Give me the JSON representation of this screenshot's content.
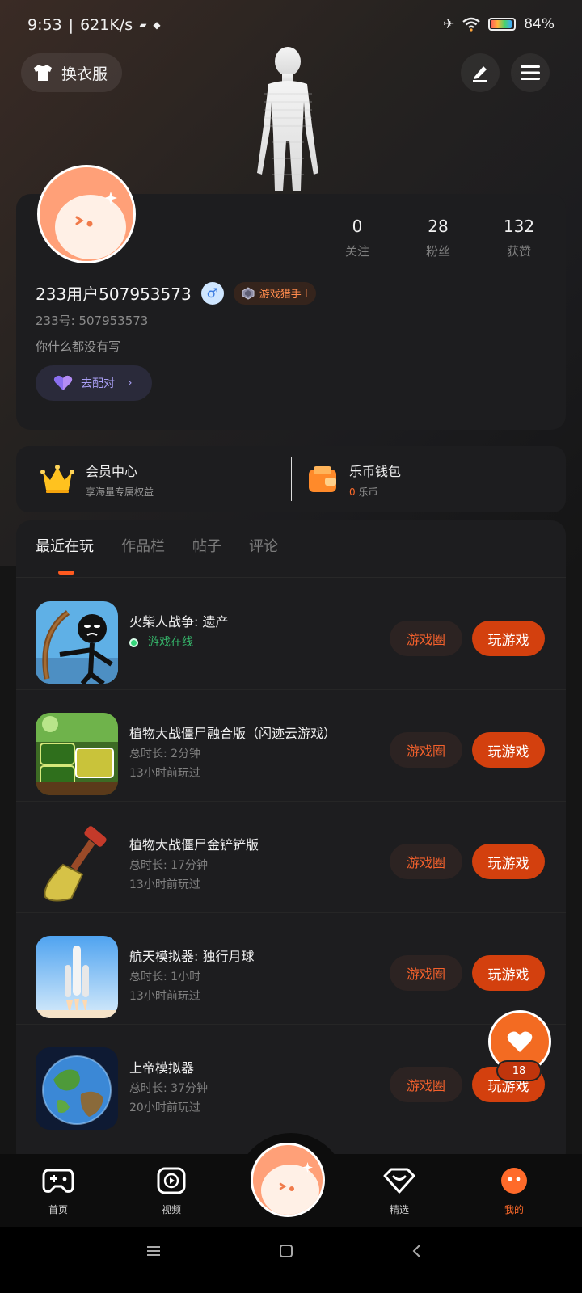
{
  "status_bar": {
    "time": "9:53",
    "speed": "621K/s",
    "battery": "84%"
  },
  "header": {
    "outfit_label": "换衣服",
    "edit_icon": "pencil-icon",
    "menu_icon": "hamburger-icon"
  },
  "profile": {
    "stats": [
      {
        "value": "0",
        "label": "关注"
      },
      {
        "value": "28",
        "label": "粉丝"
      },
      {
        "value": "132",
        "label": "获赞"
      }
    ],
    "username": "233用户507953573",
    "gender_symbol": "♂",
    "badge": "游戏猎手 I",
    "uid": "233号: 507953573",
    "bio": "你什么都没有写",
    "match_label": "去配对"
  },
  "membership": {
    "vip_title": "会员中心",
    "vip_sub": "享海量专属权益",
    "wallet_title": "乐币钱包",
    "wallet_amount": "0",
    "wallet_unit": "乐币"
  },
  "tabs": [
    "最近在玩",
    "作品栏",
    "帖子",
    "评论"
  ],
  "games": [
    {
      "name": "火柴人战争: 遗产",
      "online": "游戏在线",
      "meta1": "",
      "meta2": "",
      "circle": "游戏圈",
      "play": "玩游戏"
    },
    {
      "name": "植物大战僵尸融合版（闪迹云游戏）",
      "online": "",
      "meta1": "总时长: 2分钟",
      "meta2": "13小时前玩过",
      "circle": "游戏圈",
      "play": "玩游戏"
    },
    {
      "name": "植物大战僵尸金铲铲版",
      "online": "",
      "meta1": "总时长: 17分钟",
      "meta2": "13小时前玩过",
      "circle": "游戏圈",
      "play": "玩游戏"
    },
    {
      "name": "航天模拟器: 独行月球",
      "online": "",
      "meta1": "总时长: 1小时",
      "meta2": "13小时前玩过",
      "circle": "游戏圈",
      "play": "玩游戏"
    },
    {
      "name": "上帝模拟器",
      "online": "",
      "meta1": "总时长: 37分钟",
      "meta2": "20小时前玩过",
      "circle": "游戏圈",
      "play": "玩游戏"
    }
  ],
  "like": {
    "count": "18"
  },
  "bottom_nav": [
    {
      "label": "首页",
      "icon": "gamepad-icon"
    },
    {
      "label": "视频",
      "icon": "video-play-icon"
    },
    {
      "label": "精选",
      "icon": "heart-shield-icon"
    },
    {
      "label": "我的",
      "icon": "profile-face-icon"
    }
  ],
  "colors": {
    "accent": "#ff6a2a",
    "play_button": "#d3400e",
    "card_bg": "#1d1d1f"
  }
}
